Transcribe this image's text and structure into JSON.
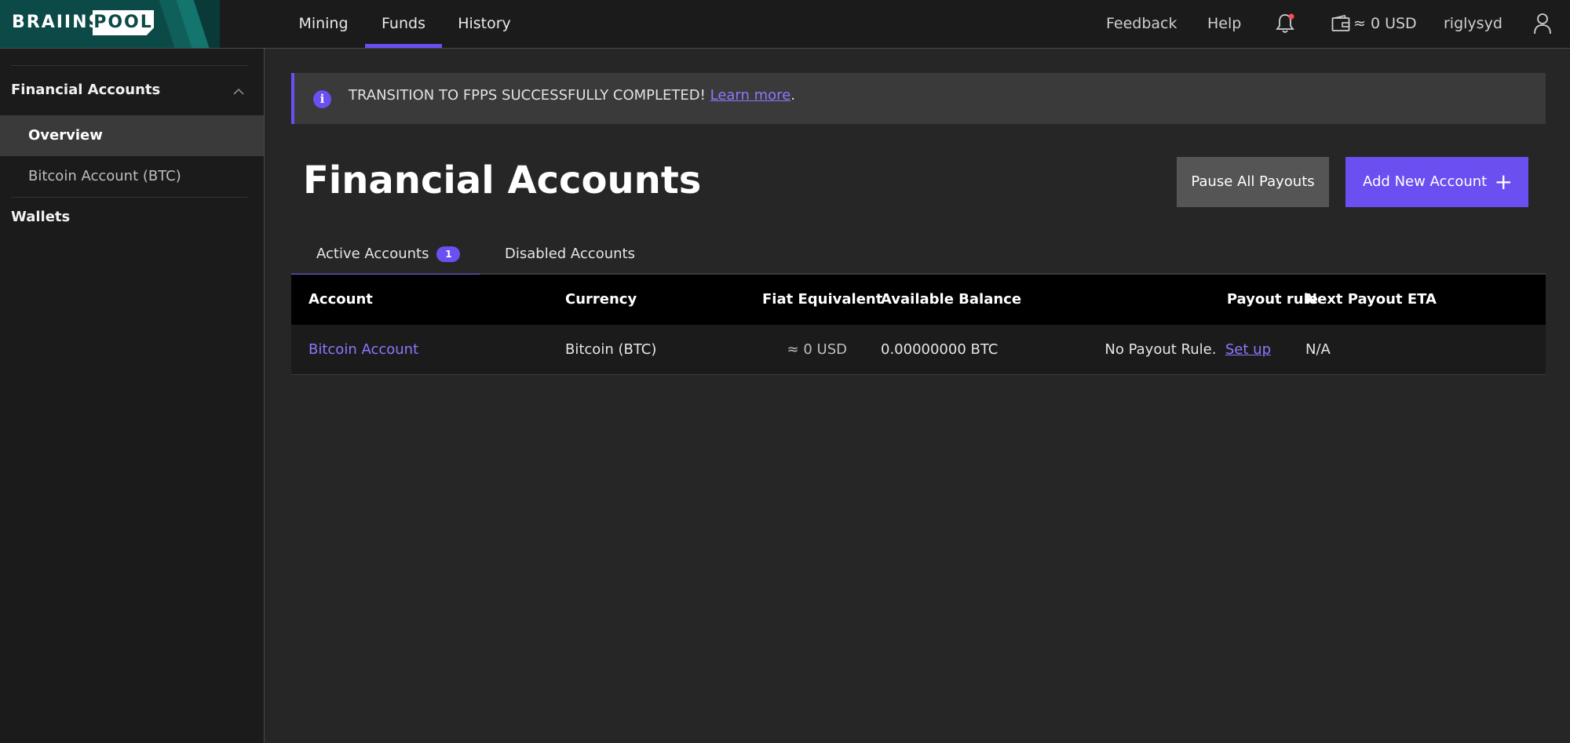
{
  "logo": {
    "left": "BRAIINS",
    "right": "POOL"
  },
  "nav": [
    {
      "label": "Mining"
    },
    {
      "label": "Funds"
    },
    {
      "label": "History"
    }
  ],
  "topbar": {
    "feedback": "Feedback",
    "help": "Help",
    "wallet_balance": "≈ 0 USD",
    "username": "riglysyd"
  },
  "sidebar": {
    "section1": "Financial Accounts",
    "items": [
      {
        "label": "Overview"
      },
      {
        "label": "Bitcoin Account (BTC)"
      }
    ],
    "section2": "Wallets"
  },
  "banner": {
    "text": "TRANSITION TO FPPS SUCCESSFULLY COMPLETED! ",
    "link": "Learn more",
    "after": "."
  },
  "page": {
    "title": "Financial Accounts",
    "pause_button": "Pause All Payouts",
    "add_button": "Add New Account"
  },
  "tabs": {
    "active_label": "Active Accounts",
    "active_count": "1",
    "disabled_label": "Disabled Accounts"
  },
  "table": {
    "headers": {
      "account": "Account",
      "currency": "Currency",
      "fiat": "Fiat Equivalent",
      "balance": "Available Balance",
      "payout_rule": "Payout rule",
      "eta": "Next Payout ETA"
    },
    "rows": [
      {
        "account": "Bitcoin Account",
        "currency": "Bitcoin (BTC)",
        "fiat": "≈ 0 USD",
        "balance": "0.00000000 BTC",
        "payout_rule": "No Payout Rule.",
        "payout_link": "Set up",
        "eta": "N/A"
      }
    ]
  },
  "colors": {
    "accent": "#6b4ff0",
    "logo_bg": "#0c4a47",
    "notification_dot": "#ff4d4d"
  }
}
